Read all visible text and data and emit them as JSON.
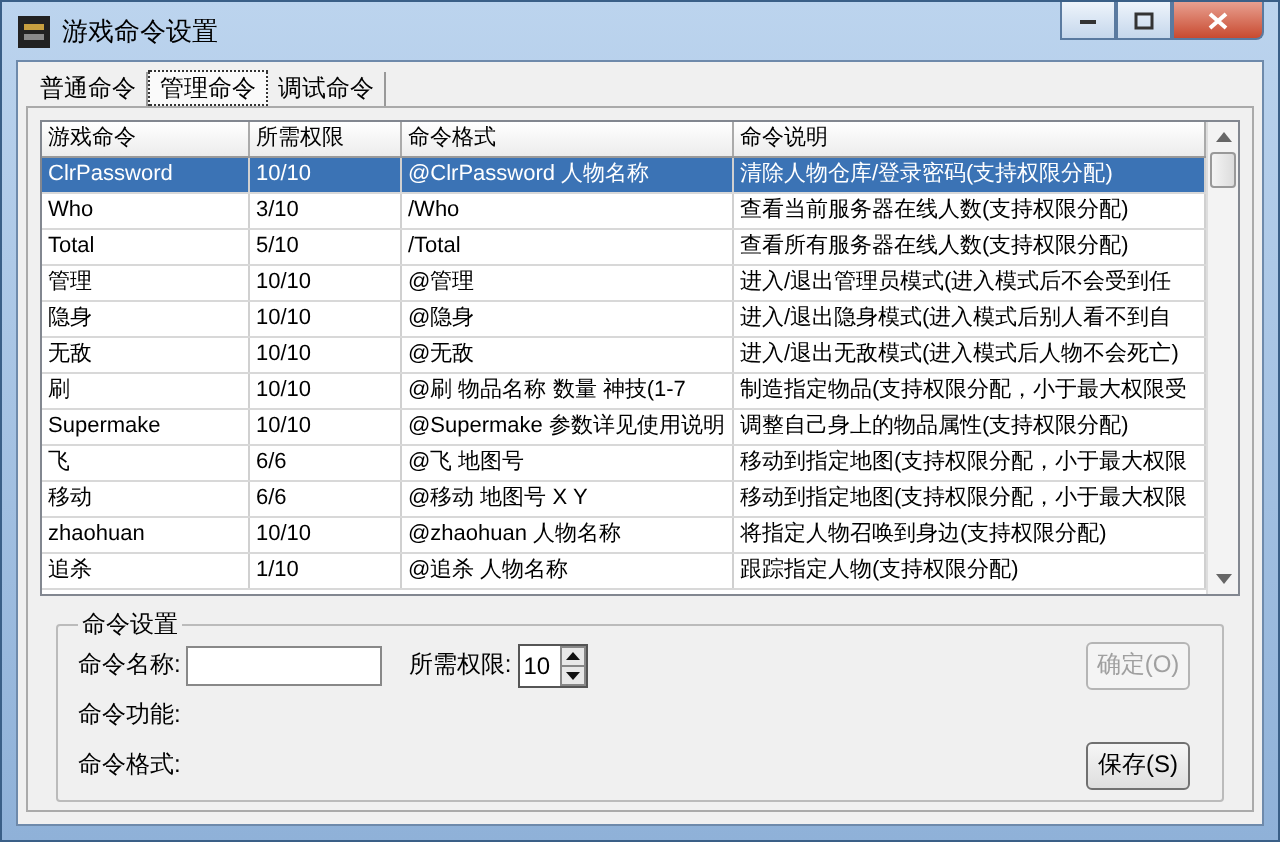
{
  "window": {
    "title": "游戏命令设置"
  },
  "tabs": [
    {
      "label": "普通命令",
      "selected": false
    },
    {
      "label": "管理命令",
      "selected": true
    },
    {
      "label": "调试命令",
      "selected": false
    }
  ],
  "table": {
    "columns": [
      "游戏命令",
      "所需权限",
      "命令格式",
      "命令说明"
    ],
    "rows": [
      {
        "cells": [
          "ClrPassword",
          "10/10",
          "@ClrPassword 人物名称",
          "清除人物仓库/登录密码(支持权限分配)"
        ],
        "selected": true
      },
      {
        "cells": [
          "Who",
          "3/10",
          "/Who",
          "查看当前服务器在线人数(支持权限分配)"
        ],
        "selected": false
      },
      {
        "cells": [
          "Total",
          "5/10",
          "/Total",
          "查看所有服务器在线人数(支持权限分配)"
        ],
        "selected": false
      },
      {
        "cells": [
          "管理",
          "10/10",
          "@管理",
          "进入/退出管理员模式(进入模式后不会受到任"
        ],
        "selected": false
      },
      {
        "cells": [
          "隐身",
          "10/10",
          "@隐身",
          "进入/退出隐身模式(进入模式后别人看不到自"
        ],
        "selected": false
      },
      {
        "cells": [
          "无敌",
          "10/10",
          "@无敌",
          "进入/退出无敌模式(进入模式后人物不会死亡)"
        ],
        "selected": false
      },
      {
        "cells": [
          "刷",
          "10/10",
          "@刷 物品名称 数量 神技(1-7",
          "制造指定物品(支持权限分配，小于最大权限受"
        ],
        "selected": false
      },
      {
        "cells": [
          "Supermake",
          "10/10",
          "@Supermake 参数详见使用说明",
          "调整自己身上的物品属性(支持权限分配)"
        ],
        "selected": false
      },
      {
        "cells": [
          "飞",
          "6/6",
          "@飞 地图号",
          "移动到指定地图(支持权限分配，小于最大权限"
        ],
        "selected": false
      },
      {
        "cells": [
          "移动",
          "6/6",
          "@移动 地图号 X Y",
          "移动到指定地图(支持权限分配，小于最大权限"
        ],
        "selected": false
      },
      {
        "cells": [
          "zhaohuan",
          "10/10",
          "@zhaohuan 人物名称",
          "将指定人物召唤到身边(支持权限分配)"
        ],
        "selected": false
      },
      {
        "cells": [
          "追杀",
          "1/10",
          "@追杀 人物名称",
          "跟踪指定人物(支持权限分配)"
        ],
        "selected": false
      }
    ]
  },
  "settings": {
    "title": "命令设置",
    "name_label": "命令名称:",
    "level_label": "所需权限:",
    "level_value": "10",
    "function_label": "命令功能:",
    "format_label": "命令格式:",
    "buttons": [
      {
        "label": "确定(O)",
        "disabled": true
      },
      {
        "label": "保存(S)",
        "disabled": false
      }
    ]
  }
}
